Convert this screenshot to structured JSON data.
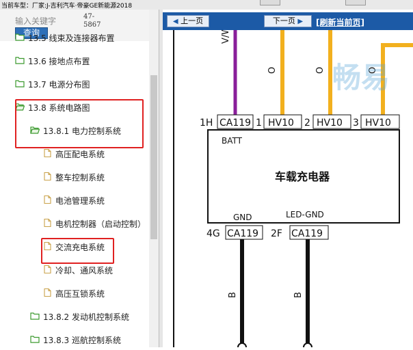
{
  "topbar": {
    "title": "当前车型：厂家:J-吉利汽车·帝豪GE新能源2018"
  },
  "search": {
    "placeholder": "输入关键字",
    "button_label": "查询",
    "hint": "47-\n5867"
  },
  "tree": {
    "items": [
      {
        "label": "13.5 线束及连接器布置",
        "indent": 1
      },
      {
        "label": "13.6 接地点布置",
        "indent": 1
      },
      {
        "label": "13.7 电源分布图",
        "indent": 1
      },
      {
        "label": "13.8 系统电路图",
        "indent": 1,
        "open": true
      },
      {
        "label": "13.8.1 电力控制系统",
        "indent": 2,
        "open": true
      },
      {
        "label": "高压配电系统",
        "indent": 3
      },
      {
        "label": "整车控制系统",
        "indent": 3
      },
      {
        "label": "电池管理系统",
        "indent": 3
      },
      {
        "label": "电机控制器（启动控制）",
        "indent": 3
      },
      {
        "label": "交流充电系统",
        "indent": 3,
        "selected": true
      },
      {
        "label": "冷却、通风系统",
        "indent": 3
      },
      {
        "label": "高压互锁系统",
        "indent": 3
      },
      {
        "label": "13.8.2 发动机控制系统",
        "indent": 2
      },
      {
        "label": "13.8.3 巡航控制系统",
        "indent": 2
      }
    ]
  },
  "nav": {
    "prev_label": "上一页",
    "next_label": "下一页",
    "refresh_label": "[刷新当前页]"
  },
  "diagram": {
    "component_label": "车载充电器",
    "batt_label": "BATT",
    "gnd_label": "GND",
    "led_gnd_label": "LED-GND",
    "top_pins": [
      {
        "pin": "1H",
        "connector": "CA119"
      },
      {
        "pin": "1",
        "connector": "HV10"
      },
      {
        "pin": "2",
        "connector": "HV10"
      },
      {
        "pin": "3",
        "connector": "HV10"
      }
    ],
    "bottom_pins": [
      {
        "pin": "4G",
        "connector": "CA119"
      },
      {
        "pin": "2F",
        "connector": "CA119"
      }
    ],
    "wire_top_label": "V/W",
    "wire_o_label": "O",
    "wire_b_label": "B",
    "colors": {
      "violet": "#8a1f9a",
      "orange": "#f2b01e",
      "black": "#111111",
      "nav_blue": "#1c5aa6"
    },
    "watermark": "畅易"
  }
}
